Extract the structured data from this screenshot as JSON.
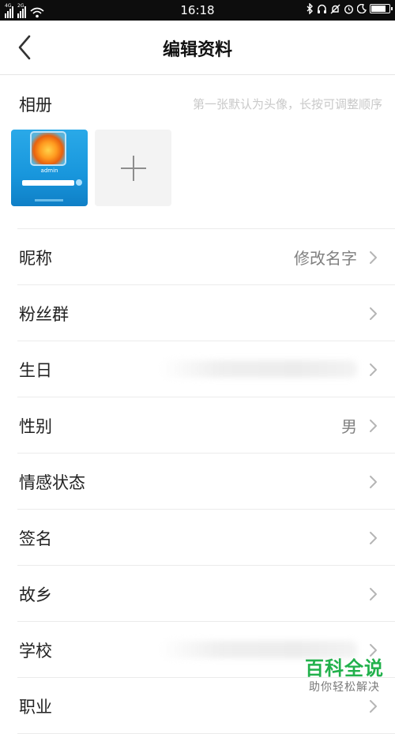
{
  "status_bar": {
    "network_1": "4G",
    "network_2": "2G",
    "time": "16:18",
    "battery_percent": 90
  },
  "header": {
    "title": "编辑资料",
    "back_icon": "chevron-left-icon"
  },
  "album": {
    "label": "相册",
    "hint": "第一张默认为头像，长按可调整顺序",
    "photo_caption": "admin",
    "add_icon": "plus-icon"
  },
  "rows": [
    {
      "label": "昵称",
      "value": "修改名字"
    },
    {
      "label": "粉丝群",
      "value": ""
    },
    {
      "label": "生日",
      "value": "",
      "blurred": true
    },
    {
      "label": "性别",
      "value": "男"
    },
    {
      "label": "情感状态",
      "value": ""
    },
    {
      "label": "签名",
      "value": ""
    },
    {
      "label": "故乡",
      "value": ""
    },
    {
      "label": "学校",
      "value": "",
      "blurred": true
    },
    {
      "label": "职业",
      "value": ""
    }
  ],
  "watermark": {
    "title": "百科全说",
    "subtitle": "助你轻松解决"
  },
  "colors": {
    "accent_green": "#22b14c",
    "hint_gray": "#c9c9c9"
  }
}
